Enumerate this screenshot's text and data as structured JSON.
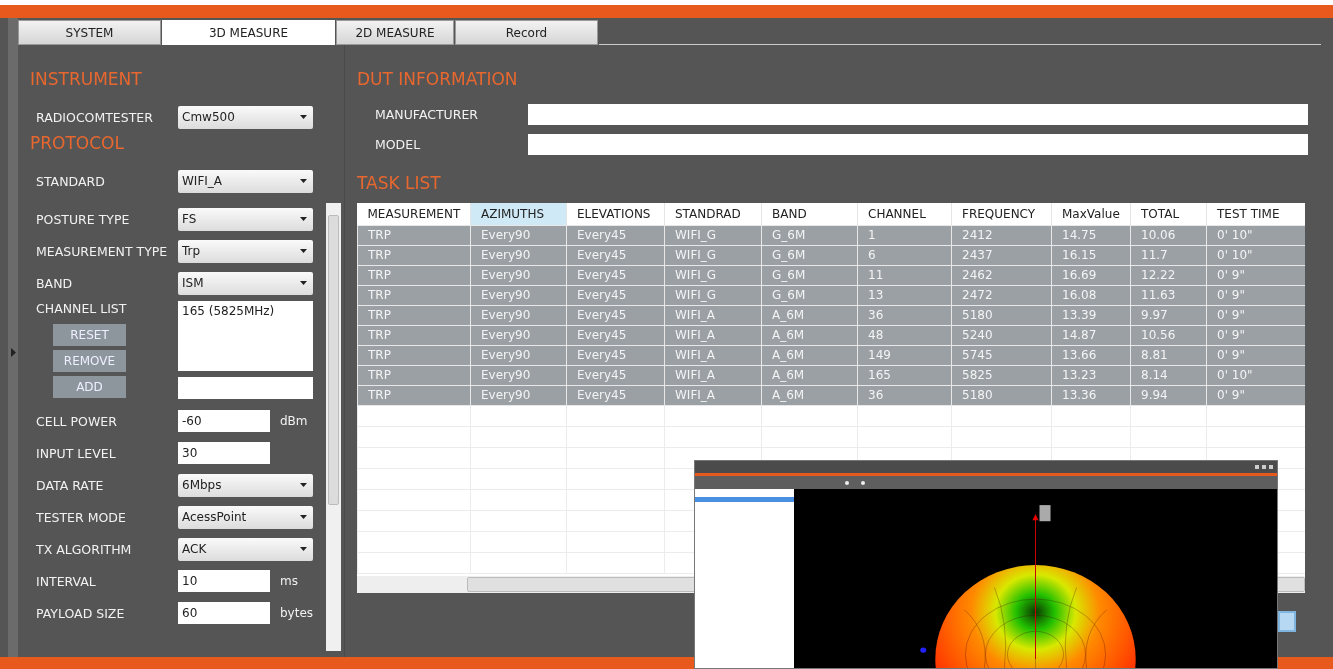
{
  "tabs": [
    {
      "label": "SYSTEM",
      "selected": false
    },
    {
      "label": "3D MEASURE",
      "selected": true
    },
    {
      "label": "2D MEASURE",
      "selected": false
    },
    {
      "label": "Record",
      "selected": false
    }
  ],
  "instrument": {
    "title": "INSTRUMENT",
    "fields": [
      {
        "kind": "dropdown",
        "label": "RADIOCOMTESTER",
        "value": "Cmw500"
      }
    ]
  },
  "protocol": {
    "title": "PROTOCOL",
    "fields": [
      {
        "kind": "dropdown",
        "label": "STANDARD",
        "value": "WIFI_A"
      }
    ]
  },
  "parameters": {
    "fields": [
      {
        "kind": "dropdown",
        "label": "POSTURE TYPE",
        "value": "FS"
      },
      {
        "kind": "dropdown",
        "label": "MEASUREMENT TYPE",
        "value": "Trp"
      },
      {
        "kind": "dropdown",
        "label": "BAND",
        "value": "ISM"
      },
      {
        "kind": "channel_list",
        "label": "CHANNEL LIST",
        "items": [
          "165 (5825MHz)"
        ],
        "buttons": [
          "RESET",
          "REMOVE",
          "ADD"
        ]
      },
      {
        "kind": "input",
        "label": "CELL POWER",
        "value": "-60",
        "unit": "dBm"
      },
      {
        "kind": "input",
        "label": "INPUT LEVEL",
        "value": "30"
      },
      {
        "kind": "dropdown",
        "label": "DATA RATE",
        "value": "6Mbps"
      },
      {
        "kind": "dropdown",
        "label": "TESTER MODE",
        "value": "AcessPoint"
      },
      {
        "kind": "dropdown",
        "label": "TX  ALGORITHM",
        "value": "ACK"
      },
      {
        "kind": "input",
        "label": "INTERVAL",
        "value": "10",
        "unit": "ms"
      },
      {
        "kind": "input",
        "label": "PAYLOAD SIZE",
        "value": "60",
        "unit": "bytes"
      }
    ]
  },
  "dut_information": {
    "title": "DUT INFORMATION",
    "fields": [
      {
        "label": "MANUFACTURER"
      },
      {
        "label": "MODEL"
      }
    ]
  },
  "task_list": {
    "title": "TASK LIST",
    "columns": [
      {
        "label": "MEASUREMENT",
        "selected": false
      },
      {
        "label": "AZIMUTHS",
        "selected": true
      },
      {
        "label": "ELEVATIONS",
        "selected": false
      },
      {
        "label": "STANDRAD",
        "selected": false
      },
      {
        "label": "BAND",
        "selected": false
      },
      {
        "label": "CHANNEL",
        "selected": false
      },
      {
        "label": "FREQUENCY",
        "selected": false
      },
      {
        "label": "MaxValue",
        "selected": false
      },
      {
        "label": "TOTAL",
        "selected": false
      },
      {
        "label": "TEST TIME",
        "selected": false
      }
    ],
    "rows": [
      [
        "TRP",
        "Every90",
        "Every45",
        "WIFI_G",
        "G_6M",
        "1",
        "2412",
        "14.75",
        "10.06",
        "0' 10\""
      ],
      [
        "TRP",
        "Every90",
        "Every45",
        "WIFI_G",
        "G_6M",
        "6",
        "2437",
        "16.15",
        "11.7",
        "0' 10\""
      ],
      [
        "TRP",
        "Every90",
        "Every45",
        "WIFI_G",
        "G_6M",
        "11",
        "2462",
        "16.69",
        "12.22",
        "0' 9\""
      ],
      [
        "TRP",
        "Every90",
        "Every45",
        "WIFI_G",
        "G_6M",
        "13",
        "2472",
        "16.08",
        "11.63",
        "0' 9\""
      ],
      [
        "TRP",
        "Every90",
        "Every45",
        "WIFI_A",
        "A_6M",
        "36",
        "5180",
        "13.39",
        "9.97",
        "0' 9\""
      ],
      [
        "TRP",
        "Every90",
        "Every45",
        "WIFI_A",
        "A_6M",
        "48",
        "5240",
        "14.87",
        "10.56",
        "0' 9\""
      ],
      [
        "TRP",
        "Every90",
        "Every45",
        "WIFI_A",
        "A_6M",
        "149",
        "5745",
        "13.66",
        "8.81",
        "0' 9\""
      ],
      [
        "TRP",
        "Every90",
        "Every45",
        "WIFI_A",
        "A_6M",
        "165",
        "5825",
        "13.23",
        "8.14",
        "0' 10\""
      ],
      [
        "TRP",
        "Every90",
        "Every45",
        "WIFI_A",
        "A_6M",
        "36",
        "5180",
        "13.36",
        "9.94",
        "0' 9\""
      ]
    ]
  }
}
